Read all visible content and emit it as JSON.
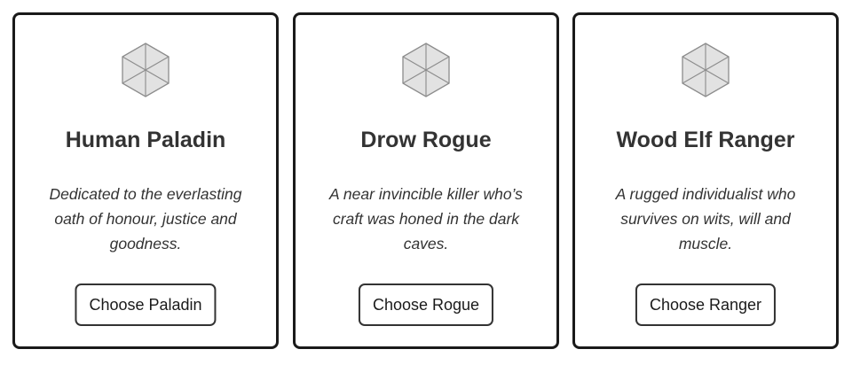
{
  "cards": [
    {
      "icon": "placeholder-cube-icon",
      "title": "Human Paladin",
      "description": "Dedicated to the everlasting oath of honour, justice and goodness.",
      "button_label": "Choose Paladin"
    },
    {
      "icon": "placeholder-cube-icon",
      "title": "Drow Rogue",
      "description": "A near invincible killer who’s craft was honed in the dark caves.",
      "button_label": "Choose Rogue"
    },
    {
      "icon": "placeholder-cube-icon",
      "title": "Wood Elf Ranger",
      "description": "A rugged individualist who survives on wits, will and muscle.",
      "button_label": "Choose Ranger"
    }
  ],
  "colors": {
    "border": "#1a1a1a",
    "text": "#333333",
    "icon_fill": "#e2e2e2",
    "icon_stroke": "#8c8c8c"
  }
}
